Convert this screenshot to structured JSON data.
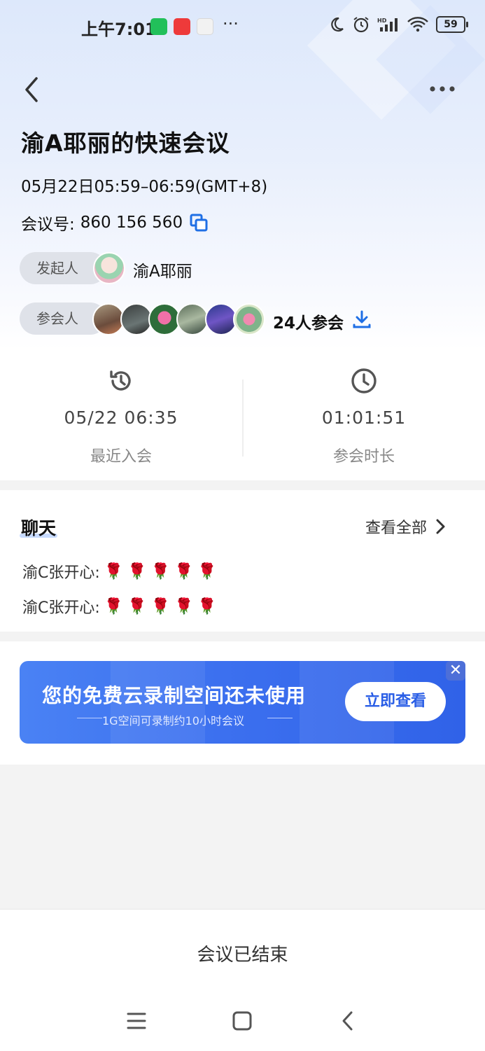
{
  "status_bar": {
    "time": "上午7:01",
    "dots": "···",
    "battery": "59",
    "icons": [
      "wechat-icon",
      "red-envelope-icon",
      "chat-bubble-icon",
      "moon-icon",
      "alarm-icon",
      "signal-hd-icon",
      "wifi-icon",
      "battery-icon"
    ]
  },
  "meeting": {
    "title": "渝A耶丽的快速会议",
    "time_range": "05月22日05:59–06:59(GMT+8)",
    "id_label": "会议号:",
    "id_value": "860 156 560",
    "host_label": "发起人",
    "host_name": "渝A耶丽",
    "participants_label": "参会人",
    "participant_count": "24人参会"
  },
  "stats": {
    "recent_join_value": "05/22 06:35",
    "recent_join_label": "最近入会",
    "duration_value": "01:01:51",
    "duration_label": "参会时长"
  },
  "chat": {
    "title": "聊天",
    "view_all": "查看全部",
    "messages": [
      {
        "sender": "渝C张开心:",
        "text": "🌹🌹🌹🌹🌹"
      },
      {
        "sender": "渝C张开心:",
        "text": "🌹🌹🌹🌹🌹"
      }
    ]
  },
  "banner": {
    "title": "您的免费云录制空间还未使用",
    "subtitle": "1G空间可录制约10小时会议",
    "button": "立即查看",
    "close": "✕"
  },
  "footer": {
    "status": "会议已结束"
  },
  "colors": {
    "accent": "#1f6fe5",
    "banner": "#3c70ef"
  }
}
